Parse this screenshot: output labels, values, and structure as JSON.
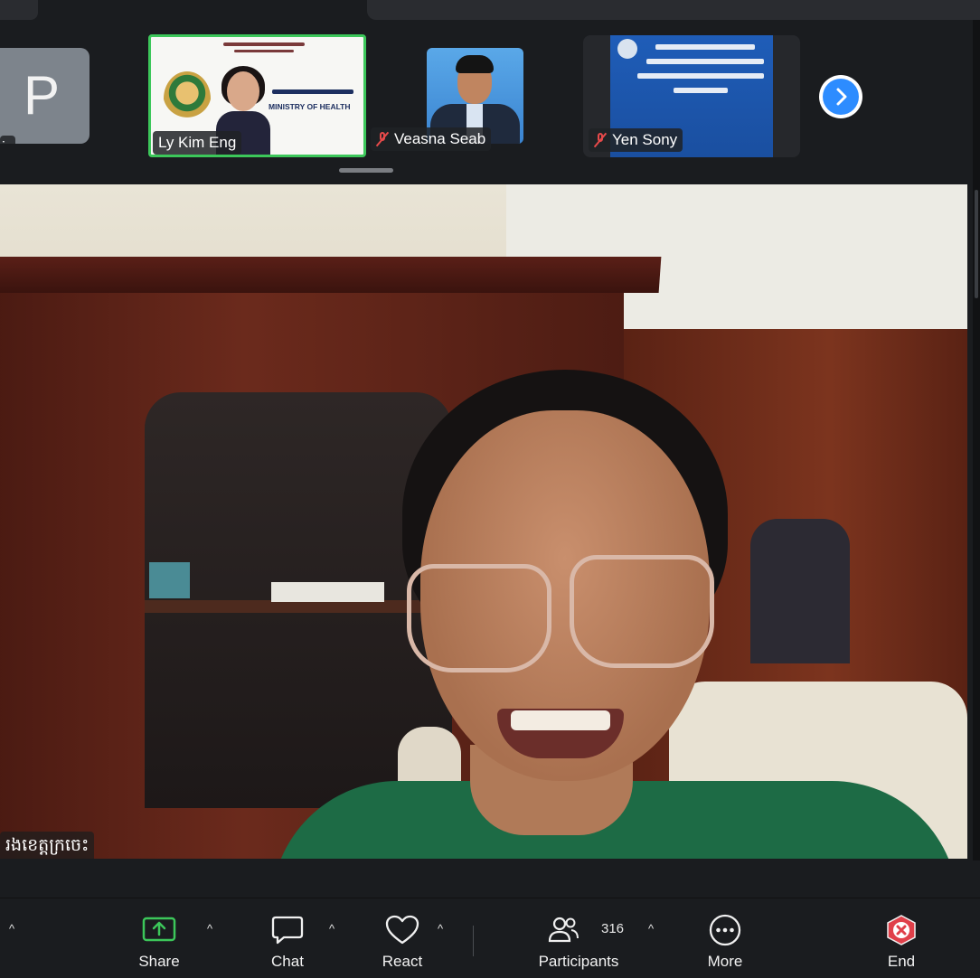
{
  "thumbnails": [
    {
      "id": "p",
      "initial": "P",
      "name": "in"
    },
    {
      "id": "ly",
      "name": "Ly Kim Eng",
      "slide_text": "MINISTRY OF HEALTH",
      "active": true
    },
    {
      "id": "vs",
      "name": "Veasna Seab",
      "muted": true
    },
    {
      "id": "ys",
      "name": "Yen Sony",
      "muted": true
    }
  ],
  "main_speaker": {
    "name": "រងខេត្តក្រចេះ"
  },
  "toolbar": {
    "share_label": "Share",
    "chat_label": "Chat",
    "react_label": "React",
    "participants_label": "Participants",
    "participants_count": "316",
    "more_label": "More",
    "end_label": "End"
  },
  "icons": {
    "next": "chevron-right-icon",
    "share": "share-screen-icon",
    "chat": "chat-bubble-icon",
    "react": "heart-icon",
    "participants": "people-icon",
    "more": "ellipsis-icon",
    "end": "end-x-icon",
    "mute": "muted-mic-icon"
  },
  "colors": {
    "active_border": "#3cc75a",
    "accent": "#2d8cff",
    "end": "#e0404a",
    "share": "#3cc75a"
  }
}
